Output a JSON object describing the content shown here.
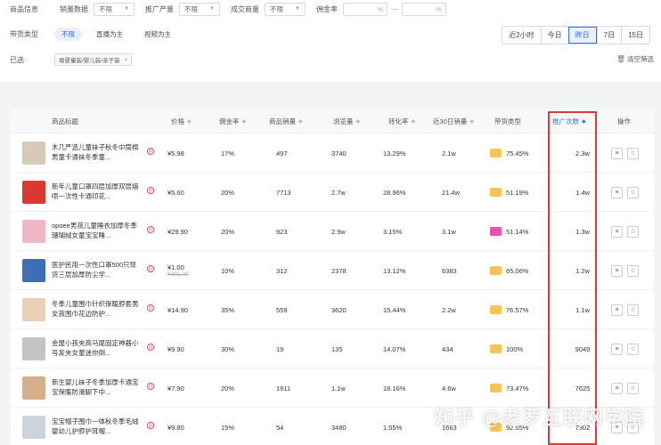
{
  "filters": {
    "row1": {
      "label": "商品信息",
      "groups": [
        {
          "label": "销量数据",
          "value": "不限"
        },
        {
          "label": "推广产量",
          "value": "不限"
        },
        {
          "label": "成交商量",
          "value": "不限"
        }
      ],
      "commission_label": "佣金率",
      "commission_min_unit": "%",
      "commission_max_unit": "%"
    },
    "row2": {
      "label": "带货类型",
      "options": [
        "不限",
        "直播为主",
        "视频为主"
      ],
      "active": 0
    },
    "row3": {
      "label": "已选",
      "tag": "母婴童装/婴儿装/亲子装"
    },
    "dates": [
      "近2小时",
      "今日",
      "昨日",
      "7日",
      "15日"
    ],
    "dates_active": 2,
    "clear_label": "清空筛选"
  },
  "table": {
    "headers": {
      "title": "商品标题",
      "price": "价格",
      "commission": "佣金率",
      "sales": "商品销量",
      "views": "浏览量",
      "conversion": "转化率",
      "sales30": "近30日销量",
      "type": "带货类型",
      "promotions": "推广次数",
      "actions": "操作"
    },
    "rows": [
      {
        "title": "木几严选儿童袜子秋冬中筒棉男童卡通袜冬季童...",
        "price": "¥5.98",
        "price_orig": "",
        "commission": "17%",
        "sales": "497",
        "views": "3740",
        "conversion": "13.29%",
        "sales30": "2.1w",
        "type_pct": "75.45%",
        "type_color": "#f6c453",
        "promotions": "2.3w",
        "thumb": "#d8c9b8"
      },
      {
        "title": "新年儿童口罩四层加厚双层熔喷一次性卡通印花...",
        "price": "¥5.60",
        "price_orig": "",
        "commission": "20%",
        "sales": "7713",
        "views": "2.7w",
        "conversion": "28.96%",
        "sales30": "21.4w",
        "type_pct": "51.19%",
        "type_color": "#f6c453",
        "promotions": "1.4w",
        "thumb": "#d9392f"
      },
      {
        "title": "opoee男孩儿童睡衣加厚冬季珊瑚绒女童宝宝睡...",
        "price": "¥29.90",
        "price_orig": "",
        "commission": "20%",
        "sales": "923",
        "views": "2.9w",
        "conversion": "3.15%",
        "sales30": "3.1w",
        "type_pct": "51.14%",
        "type_color": "#e94fb2",
        "promotions": "1.3w",
        "thumb": "#f0b6c6"
      },
      {
        "title": "医护民用一次性口罩500只现货三层加厚防尘学...",
        "price": "¥1.00",
        "price_orig": "¥201.00",
        "commission": "10%",
        "sales": "312",
        "views": "2378",
        "conversion": "13.12%",
        "sales30": "6383",
        "type_pct": "65.06%",
        "type_color": "#f6c453",
        "promotions": "1.2w",
        "thumb": "#3e6fb5"
      },
      {
        "title": "冬季儿童围巾针织保暖脖套男女孩围巾花边防护...",
        "price": "¥14.90",
        "price_orig": "",
        "commission": "35%",
        "sales": "559",
        "views": "3620",
        "conversion": "15.44%",
        "sales30": "2.2w",
        "type_pct": "76.57%",
        "type_color": "#f6c453",
        "promotions": "1.1w",
        "thumb": "#e9cfb5"
      },
      {
        "title": "金屋小孩夹高马尾固定神器小号发夹女童迷你倒...",
        "price": "¥9.90",
        "price_orig": "",
        "commission": "30%",
        "sales": "19",
        "views": "135",
        "conversion": "14.07%",
        "sales30": "434",
        "type_pct": "100%",
        "type_color": "#f6c453",
        "promotions": "9049",
        "thumb": "#c4c4c4"
      },
      {
        "title": "新生婴儿袜子冬季加厚卡通宝宝保暖防滑脚下中...",
        "price": "¥7.90",
        "price_orig": "",
        "commission": "20%",
        "sales": "1911",
        "views": "1.1w",
        "conversion": "18.16%",
        "sales30": "4.6w",
        "type_pct": "73.47%",
        "type_color": "#f6c453",
        "promotions": "7625",
        "thumb": "#d6b08a"
      },
      {
        "title": "宝宝帽子围巾一体秋冬季毛绒婴幼儿护脖护耳帽...",
        "price": "¥9.80",
        "price_orig": "",
        "commission": "15%",
        "sales": "54",
        "views": "3480",
        "conversion": "1.55%",
        "sales30": "1663",
        "type_pct": "92.55%",
        "type_color": "#f6c453",
        "promotions": "7302",
        "thumb": "#cdd3dc"
      }
    ]
  },
  "watermark": "知乎 @老罗互联网学院"
}
